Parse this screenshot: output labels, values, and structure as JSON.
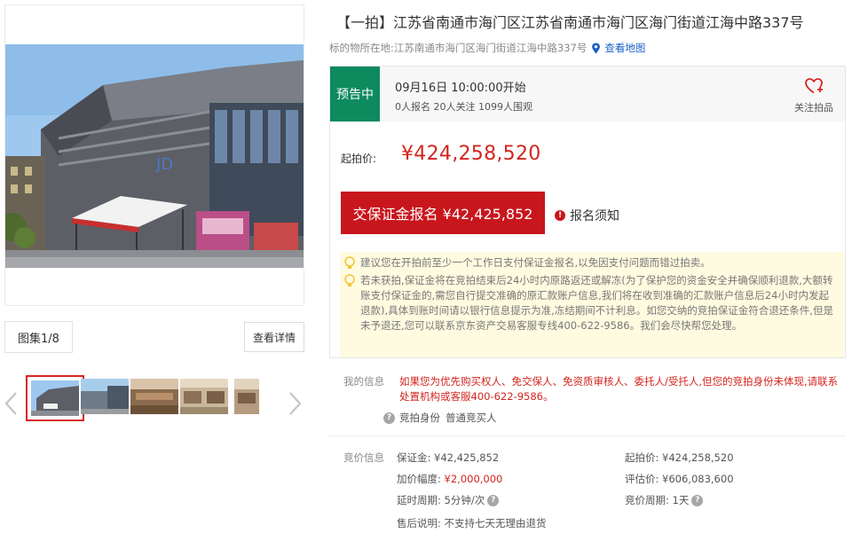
{
  "gallery": {
    "count_label": "图集1/8",
    "detail_button": "查看详情",
    "thumbnail_count": 5,
    "active_thumbnail": 1
  },
  "listing": {
    "title": "【一拍】江苏省南通市海门区江苏省南通市海门区海门街道江海中路337号",
    "location_label": "标的物所在地:",
    "location_value": "江苏南通市海门区海门街道江海中路337号",
    "map_link": "查看地图"
  },
  "status": {
    "badge": "预告中",
    "start_time": "09月16日 10:00:00开始",
    "stats": "0人报名 20人关注 1099人围观",
    "follow_label": "关注拍品"
  },
  "price": {
    "start_label": "起拍价:",
    "start_value": "¥424,258,520"
  },
  "actions": {
    "deposit_button": "交保证金报名 ¥42,425,852",
    "notice_link": "报名须知"
  },
  "tips": [
    "建议您在开拍前至少一个工作日支付保证金报名,以免因支付问题而错过拍卖。",
    "若未获拍,保证金将在竞拍结束后24小时内原路返还或解冻(为了保护您的资金安全并确保顺利退款,大额转账支付保证金的,需您自行提交准确的原汇款账户信息,我们将在收到准确的汇款账户信息后24小时内发起退款),具体到账时间请以银行信息提示为准,冻结期间不计利息。如您交纳的竞拍保证金符合退还条件,但是未予退还,您可以联系京东资产交易客服专线400-622-9586。我们会尽快帮您处理。"
  ],
  "my_info": {
    "label": "我的信息",
    "text": "如果您为优先购买权人、免交保人、免资质审核人、委托人/受托人,但您的竞拍身份未体现,请联系处置机构或客服400-622-9586。",
    "role_label": "竞拍身份",
    "role_value": "普通竞买人"
  },
  "bid_info": {
    "label": "竞价信息",
    "deposit_label": "保证金:",
    "deposit_value": "¥42,425,852",
    "start_label": "起拍价:",
    "start_value": "¥424,258,520",
    "increment_label": "加价幅度:",
    "increment_value": "¥2,000,000",
    "appraisal_label": "评估价:",
    "appraisal_value": "¥606,083,600",
    "delay_label": "延时周期:",
    "delay_value": "5分钟/次",
    "cycle_label": "竞价周期:",
    "cycle_value": "1天",
    "after_sale_label": "售后说明:",
    "after_sale_value": "不支持七天无理由退货"
  },
  "colors": {
    "accent_red": "#c8161d",
    "price_red": "#d2251f",
    "status_green": "#0e8a5f",
    "link_blue": "#1a60c8",
    "tip_bg": "#fffbe0"
  }
}
